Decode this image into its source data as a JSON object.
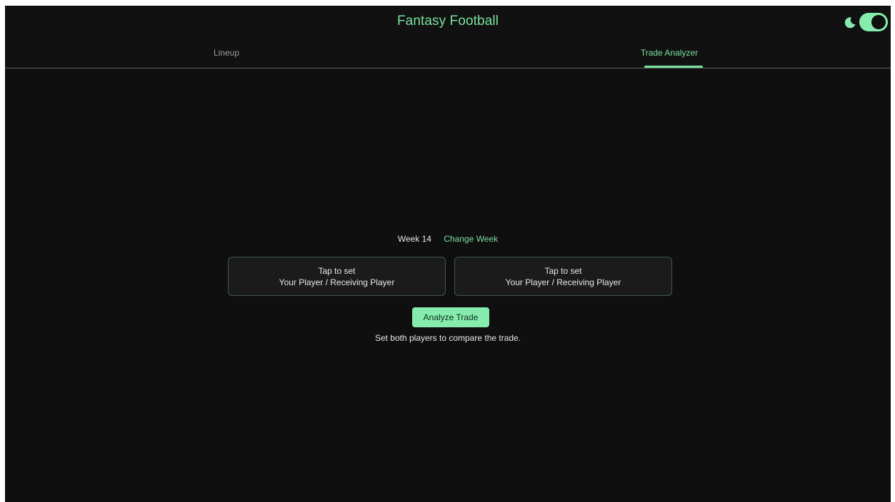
{
  "app": {
    "title": "Fantasy Football"
  },
  "theme_toggle": {
    "icon": "moon-icon",
    "state": "on"
  },
  "tabs": [
    {
      "label": "Lineup",
      "active": false
    },
    {
      "label": "Trade Analyzer",
      "active": true
    }
  ],
  "week": {
    "label": "Week 14",
    "change_label": "Change Week"
  },
  "player_cards": [
    {
      "line1": "Tap to set",
      "line2": "Your Player / Receiving Player"
    },
    {
      "line1": "Tap to set",
      "line2": "Your Player / Receiving Player"
    }
  ],
  "analyze_button": {
    "label": "Analyze Trade"
  },
  "hint": "Set both players to compare the trade.",
  "colors": {
    "accent": "#7be0a0",
    "button_bg": "#86ecae",
    "background": "#0f0f0f"
  }
}
